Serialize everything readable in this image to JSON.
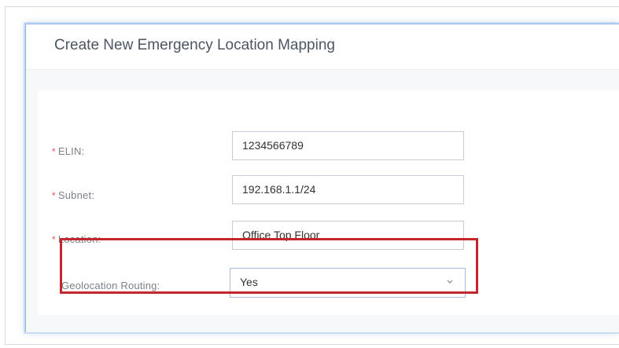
{
  "dialog": {
    "title": "Create New Emergency Location Mapping"
  },
  "form": {
    "fields": [
      {
        "label": "ELIN:",
        "required": true,
        "value": "1234566789"
      },
      {
        "label": "Subnet:",
        "required": true,
        "value": "192.168.1.1/24"
      },
      {
        "label": "Location:",
        "required": true,
        "value": "Office Top Floor"
      },
      {
        "label": "Geolocation Routing:",
        "required": false,
        "value": "Yes",
        "type": "select"
      }
    ]
  },
  "annotation": {
    "highlight_color": "#c1272d"
  },
  "icons": {
    "required_marker": "asterisk-icon",
    "dropdown": "chevron-down-icon"
  }
}
